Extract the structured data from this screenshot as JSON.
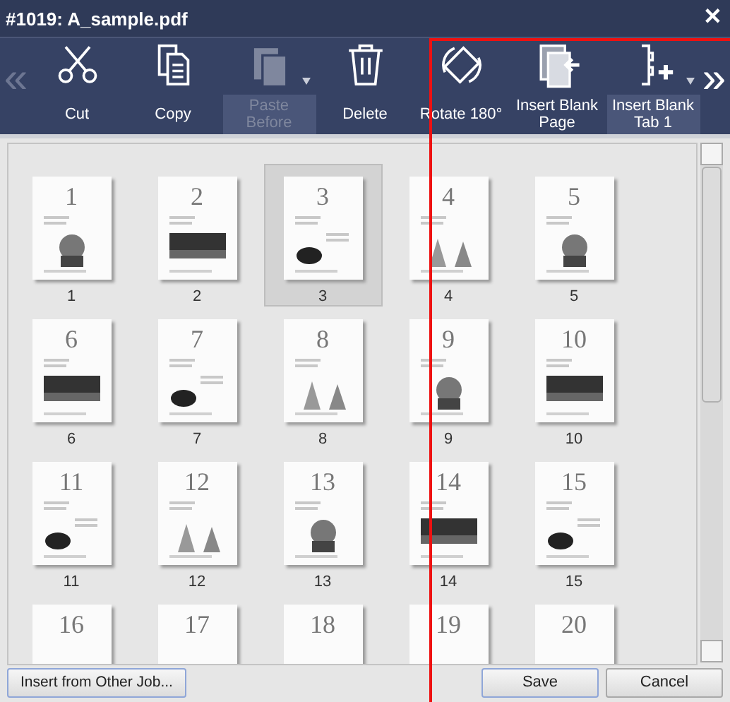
{
  "window": {
    "title": "#1019: A_sample.pdf",
    "close": "✕"
  },
  "toolbar": {
    "scroll_left": "«",
    "scroll_right": "»",
    "items": [
      {
        "label": "Cut",
        "kind": "scissors",
        "disabled": false,
        "dropdown": false
      },
      {
        "label": "Copy",
        "kind": "copy",
        "disabled": false,
        "dropdown": false
      },
      {
        "label": "Paste Before",
        "kind": "paste",
        "disabled": true,
        "dropdown": true
      },
      {
        "label": "Delete",
        "kind": "trash",
        "disabled": false,
        "dropdown": false
      },
      {
        "label": "Rotate 180°",
        "kind": "rotate",
        "disabled": false,
        "dropdown": false
      },
      {
        "label": "Insert Blank Page",
        "kind": "insert-page",
        "disabled": false,
        "dropdown": false
      },
      {
        "label": "Insert Blank Tab 1",
        "kind": "insert-tab",
        "disabled": false,
        "dropdown": true
      }
    ]
  },
  "pages": [
    {
      "page_number": "1",
      "label": "1",
      "selected": false
    },
    {
      "page_number": "2",
      "label": "2",
      "selected": false
    },
    {
      "page_number": "3",
      "label": "3",
      "selected": true
    },
    {
      "page_number": "4",
      "label": "4",
      "selected": false
    },
    {
      "page_number": "5",
      "label": "5",
      "selected": false
    },
    {
      "page_number": "6",
      "label": "6",
      "selected": false
    },
    {
      "page_number": "7",
      "label": "7",
      "selected": false
    },
    {
      "page_number": "8",
      "label": "8",
      "selected": false
    },
    {
      "page_number": "9",
      "label": "9",
      "selected": false
    },
    {
      "page_number": "10",
      "label": "10",
      "selected": false
    },
    {
      "page_number": "11",
      "label": "11",
      "selected": false
    },
    {
      "page_number": "12",
      "label": "12",
      "selected": false
    },
    {
      "page_number": "13",
      "label": "13",
      "selected": false
    },
    {
      "page_number": "14",
      "label": "14",
      "selected": false
    },
    {
      "page_number": "15",
      "label": "15",
      "selected": false
    },
    {
      "page_number": "16",
      "selected": false
    },
    {
      "page_number": "17",
      "selected": false
    },
    {
      "page_number": "18",
      "selected": false
    },
    {
      "page_number": "19",
      "selected": false
    },
    {
      "page_number": "20",
      "selected": false
    }
  ],
  "buttons": {
    "left": [
      "Insert from Other Job..."
    ],
    "right": [
      "Save",
      "Cancel"
    ]
  },
  "highlight_frame": true
}
